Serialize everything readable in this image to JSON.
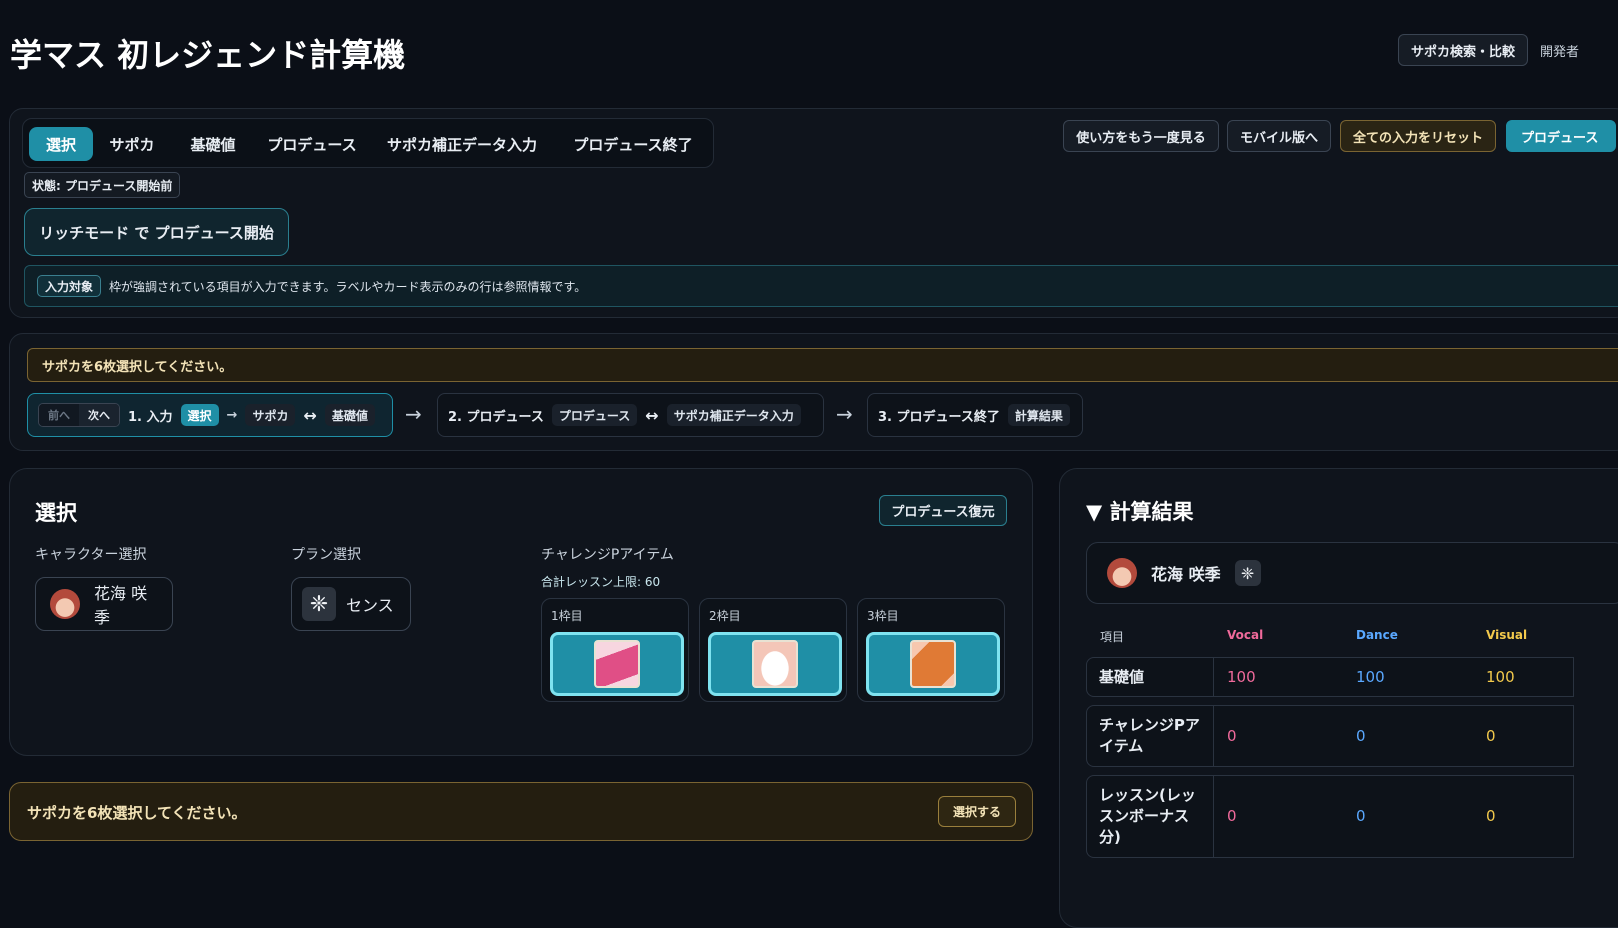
{
  "app": {
    "title": "学マス 初レジェンド計算機",
    "header_buttons": [
      "サポカ検索・比較",
      "開発者"
    ]
  },
  "nav": {
    "tabs": [
      "選択",
      "サポカ",
      "基礎値",
      "プロデュース",
      "サポカ補正データ入力",
      "プロデュース終了"
    ],
    "active_tab": "選択",
    "actions": [
      "使い方をもう一度見る",
      "モバイル版へ",
      "全ての入力をリセット",
      "プロデュース"
    ],
    "status": "状態: プロデュース開始前",
    "start_button": "リッチモード で プロデュース開始",
    "info_tag": "入力対象",
    "info_text": "枠が強調されている項目が入力できます。ラベルやカード表示のみの行は参照情報です。"
  },
  "flow": {
    "warning": "サポカを6枚選択してください。",
    "prev": "前へ",
    "next": "次へ",
    "step1": {
      "title": "1. 入力",
      "items": [
        "選択",
        "サポカ",
        "基礎値"
      ]
    },
    "step2": {
      "title": "2. プロデュース",
      "items": [
        "プロデュース",
        "サポカ補正データ入力"
      ]
    },
    "step3": {
      "title": "3. プロデュース終了",
      "items": [
        "計算結果"
      ]
    },
    "arrow": "→",
    "swap": "↔"
  },
  "select": {
    "heading": "選択",
    "restore_button": "プロデュース復元",
    "character_label": "キャラクター選択",
    "character_value": "花海 咲季",
    "plan_label": "プラン選択",
    "plan_value": "センス",
    "challenge_label": "チャレンジPアイテム",
    "lesson_limit": "合計レッスン上限: 60",
    "slots": [
      "1枠目",
      "2枠目",
      "3枠目"
    ]
  },
  "bottom_warning": {
    "text": "サポカを6枚選択してください。",
    "button": "選択する"
  },
  "result": {
    "heading": "▼ 計算結果",
    "character_name": "花海 咲季",
    "columns": [
      "項目",
      "Vocal",
      "Dance",
      "Visual"
    ],
    "rows": [
      {
        "label": "基礎値",
        "vocal": "100",
        "dance": "100",
        "visual": "100"
      },
      {
        "label": "チャレンジPアイテム",
        "vocal": "0",
        "dance": "0",
        "visual": "0"
      },
      {
        "label": "レッスン(レッスンボーナス分)",
        "vocal": "0",
        "dance": "0",
        "visual": "0"
      }
    ]
  },
  "colors": {
    "accent": "#1f8fa6",
    "warning_border": "#7a6432",
    "vocal": "#f06a9b",
    "dance": "#5aa8ff",
    "visual": "#f2c94c"
  },
  "icons": {
    "plan": "sense-plan-icon",
    "character": "character-avatar",
    "items": [
      "pink-card-item-icon",
      "white-hat-item-icon",
      "orange-cloth-item-icon"
    ]
  }
}
